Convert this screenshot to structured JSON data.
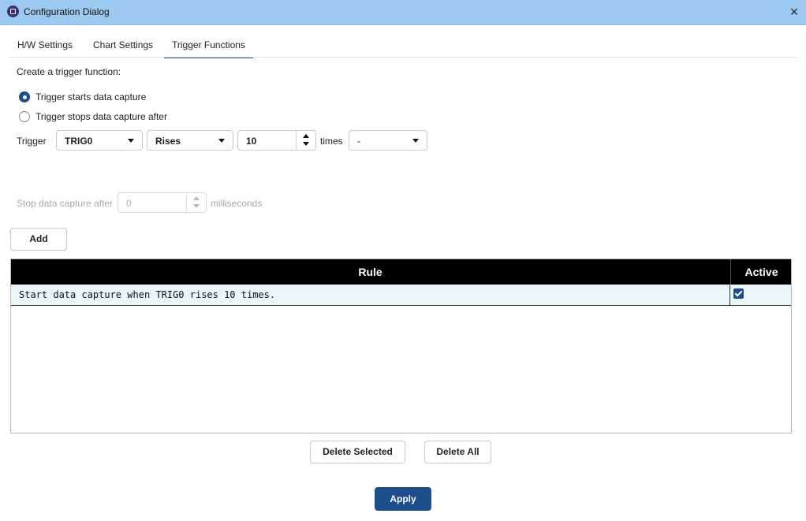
{
  "window": {
    "title": "Configuration Dialog",
    "close_icon": "×"
  },
  "tabs": [
    {
      "label": "H/W Settings",
      "active": false
    },
    {
      "label": "Chart Settings",
      "active": false
    },
    {
      "label": "Trigger Functions",
      "active": true
    }
  ],
  "form": {
    "create_label": "Create a trigger function:",
    "radio_start_label": "Trigger starts data capture",
    "radio_start_checked": true,
    "radio_stop_label": "Trigger stops data capture after",
    "radio_stop_checked": false,
    "trigger_label": "Trigger",
    "trigger_source": "TRIG0",
    "trigger_edge": "Rises",
    "trigger_count": "10",
    "times_label": "times",
    "times_option": "-",
    "stop_after_label": "Stop data capture after",
    "stop_after_value": "0",
    "milliseconds_label": "milliseconds",
    "add_button": "Add"
  },
  "table": {
    "columns": [
      "Rule",
      "Active"
    ],
    "rows": [
      {
        "rule": "Start data capture when TRIG0 rises 10 times.",
        "active": true
      }
    ]
  },
  "actions": {
    "delete_selected": "Delete Selected",
    "delete_all": "Delete All",
    "apply": "Apply"
  },
  "colors": {
    "titlebar": "#9cc9f0",
    "accent": "#1e4d8c",
    "table_header": "#000000",
    "selected_row": "#e9f7fa"
  }
}
